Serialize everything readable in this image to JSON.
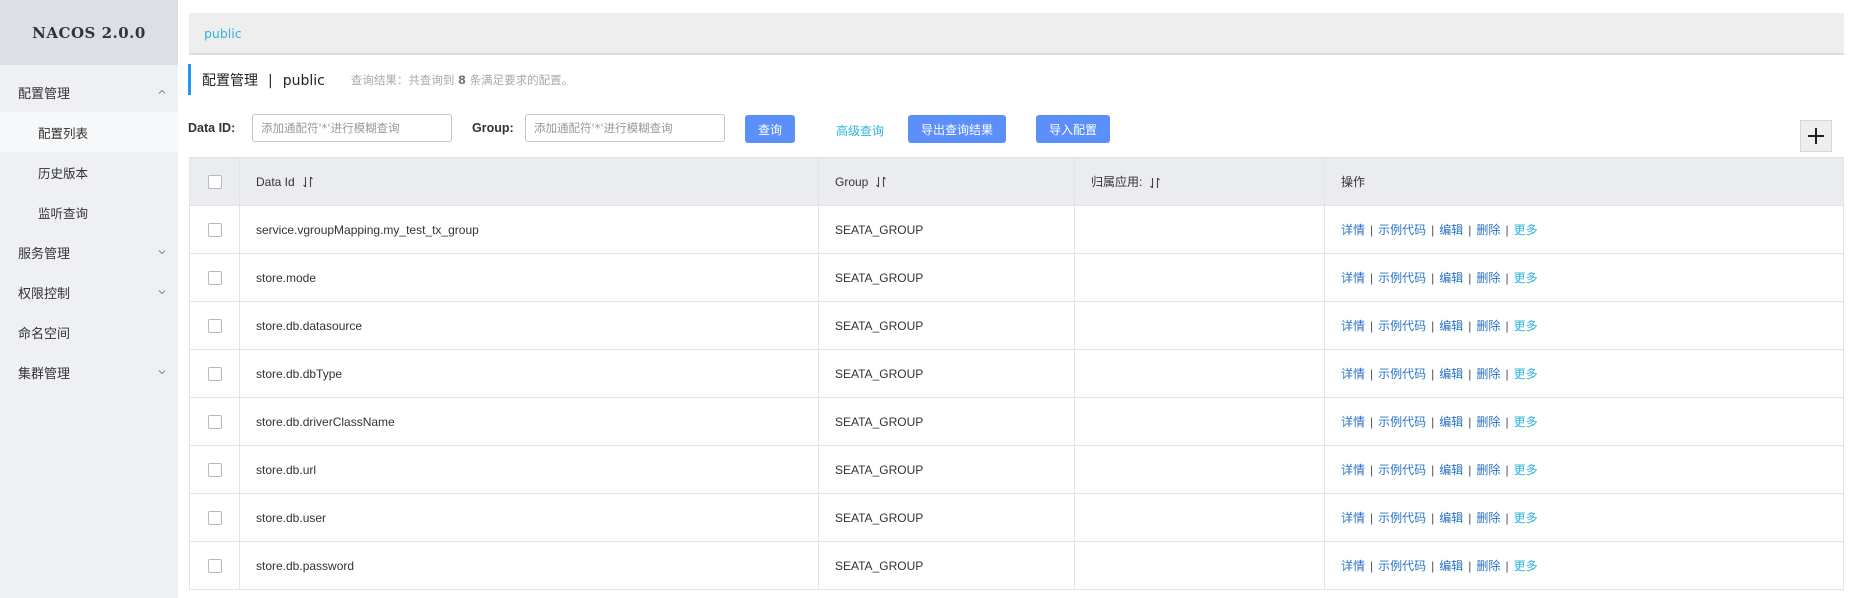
{
  "sidebar": {
    "brand": "NACOS 2.0.0",
    "groups": [
      {
        "label": "配置管理",
        "expanded": true,
        "children": [
          {
            "label": "配置列表",
            "active": true
          },
          {
            "label": "历史版本"
          },
          {
            "label": "监听查询"
          }
        ]
      },
      {
        "label": "服务管理",
        "expanded": false
      },
      {
        "label": "权限控制",
        "expanded": false
      },
      {
        "label": "命名空间"
      },
      {
        "label": "集群管理",
        "expanded": false
      }
    ]
  },
  "topbar": {
    "namespace": "public"
  },
  "header": {
    "title": "配置管理",
    "separator": "|",
    "namespace": "public",
    "query_prefix": "查询结果：共查询到",
    "query_count": "8",
    "query_suffix": "条满足要求的配置。"
  },
  "filters": {
    "data_id_label": "Data ID:",
    "data_id_placeholder": "添加通配符'*'进行模糊查询",
    "group_label": "Group:",
    "group_placeholder": "添加通配符'*'进行模糊查询",
    "query_button": "查询",
    "advanced_query": "高级查询",
    "export_button": "导出查询结果",
    "import_button": "导入配置"
  },
  "table": {
    "columns": {
      "data_id": "Data Id",
      "group": "Group",
      "app": "归属应用:",
      "ops": "操作"
    },
    "op_labels": {
      "detail": "详情",
      "sample": "示例代码",
      "edit": "编辑",
      "delete": "删除",
      "more": "更多"
    },
    "rows": [
      {
        "data_id": "service.vgroupMapping.my_test_tx_group",
        "group": "SEATA_GROUP",
        "app": ""
      },
      {
        "data_id": "store.mode",
        "group": "SEATA_GROUP",
        "app": ""
      },
      {
        "data_id": "store.db.datasource",
        "group": "SEATA_GROUP",
        "app": ""
      },
      {
        "data_id": "store.db.dbType",
        "group": "SEATA_GROUP",
        "app": ""
      },
      {
        "data_id": "store.db.driverClassName",
        "group": "SEATA_GROUP",
        "app": ""
      },
      {
        "data_id": "store.db.url",
        "group": "SEATA_GROUP",
        "app": ""
      },
      {
        "data_id": "store.db.user",
        "group": "SEATA_GROUP",
        "app": ""
      },
      {
        "data_id": "store.db.password",
        "group": "SEATA_GROUP",
        "app": ""
      }
    ]
  },
  "colors": {
    "primary_button": "#5b8ff9",
    "link": "#2d72c9",
    "accent_link": "#2fb4e0",
    "title_bar": "#2196f3"
  }
}
